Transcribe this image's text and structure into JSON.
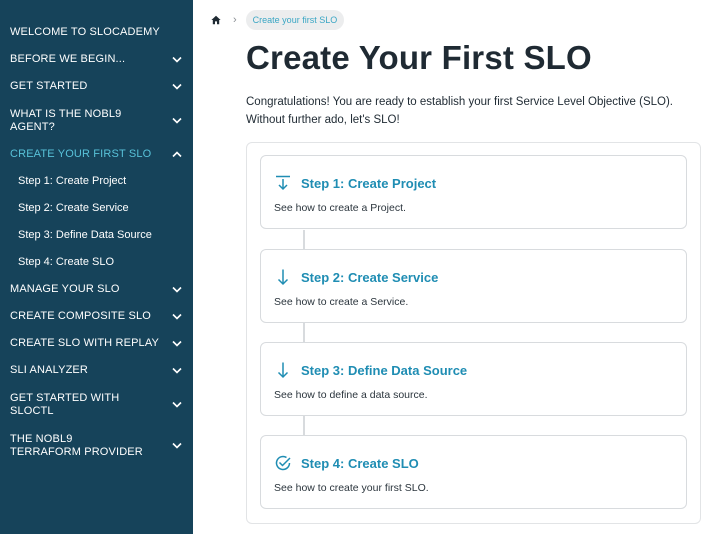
{
  "sidebar": {
    "items": [
      {
        "label": "WELCOME TO SLOCADEMY",
        "chevron": "none"
      },
      {
        "label": "BEFORE WE BEGIN...",
        "chevron": "down"
      },
      {
        "label": "GET STARTED",
        "chevron": "down"
      },
      {
        "label": "WHAT IS THE NOBL9 AGENT?",
        "chevron": "down"
      },
      {
        "label": "CREATE YOUR FIRST SLO",
        "chevron": "up",
        "active": true
      },
      {
        "label": "Step 1: Create Project",
        "chevron": "none",
        "sub": true
      },
      {
        "label": "Step 2: Create Service",
        "chevron": "none",
        "sub": true
      },
      {
        "label": "Step 3: Define Data Source",
        "chevron": "none",
        "sub": true
      },
      {
        "label": "Step 4: Create SLO",
        "chevron": "none",
        "sub": true
      },
      {
        "label": "MANAGE YOUR SLO",
        "chevron": "down"
      },
      {
        "label": "CREATE COMPOSITE SLO",
        "chevron": "down"
      },
      {
        "label": "CREATE SLO WITH REPLAY",
        "chevron": "down"
      },
      {
        "label": "SLI ANALYZER",
        "chevron": "down"
      },
      {
        "label": "GET STARTED WITH SLOCTL",
        "chevron": "down"
      },
      {
        "label": "THE NOBL9 TERRAFORM PROVIDER",
        "chevron": "down"
      }
    ]
  },
  "breadcrumb": {
    "home_icon": "home-icon",
    "separator": "›",
    "current": "Create your first SLO"
  },
  "main": {
    "title": "Create Your First SLO",
    "intro": "Congratulations! You are ready to establish your first Service Level Objective (SLO). Without further ado, let's SLO!",
    "steps": [
      {
        "title": "Step 1: Create Project",
        "description": "See how to create a Project.",
        "icon": "arrow-down-bar-icon"
      },
      {
        "title": "Step 2: Create Service",
        "description": "See how to create a Service.",
        "icon": "arrow-down-icon"
      },
      {
        "title": "Step 3: Define Data Source",
        "description": "See how to define a data source.",
        "icon": "arrow-down-icon"
      },
      {
        "title": "Step 4: Create SLO",
        "description": "See how to create your first SLO.",
        "icon": "check-circle-icon"
      }
    ]
  },
  "colors": {
    "sidebar_bg": "#16435a",
    "active": "#58c2d9",
    "accent": "#1f8db3",
    "pill_bg": "#ecedee"
  }
}
